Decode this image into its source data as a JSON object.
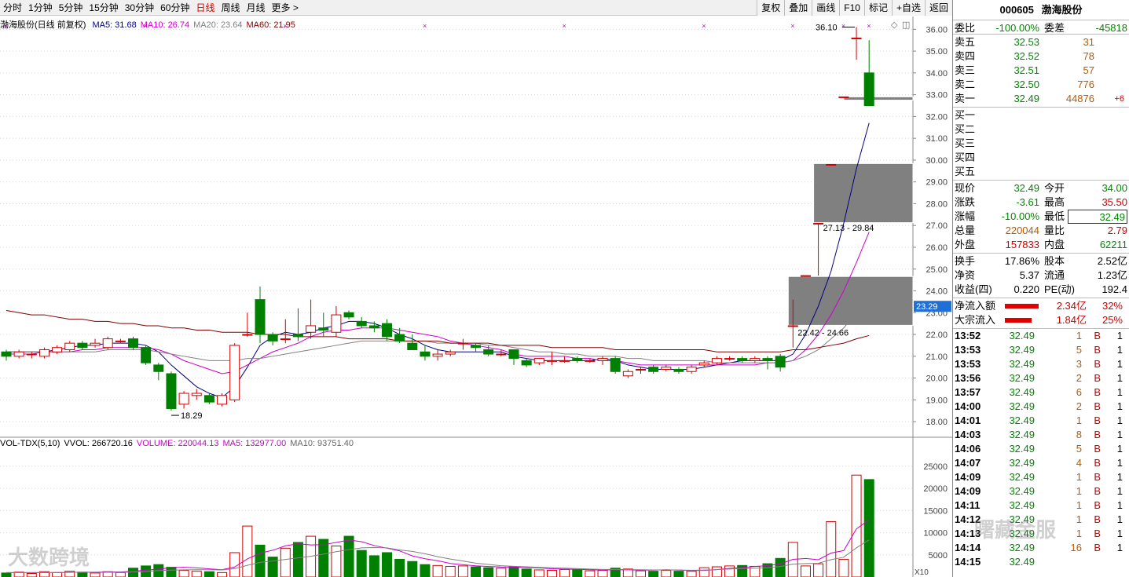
{
  "topbar": {
    "period_tabs": [
      "分时",
      "1分钟",
      "5分钟",
      "15分钟",
      "30分钟",
      "60分钟",
      "日线",
      "周线",
      "月线",
      "更多 >"
    ],
    "active_tab": "日线",
    "tools": [
      "复权",
      "叠加",
      "画线",
      "F10",
      "标记",
      "+自选",
      "返回"
    ]
  },
  "chart": {
    "title_prefix": "渤海股份(日线 前复权)",
    "ma": [
      {
        "label": "MA5: 31.68",
        "color": "#000080"
      },
      {
        "label": "MA10: 26.74",
        "color": "#cc00cc"
      },
      {
        "label": "MA20: 23.64",
        "color": "#808080"
      },
      {
        "label": "MA60: 21.95",
        "color": "#800000"
      }
    ],
    "price_axis": {
      "min": 17.5,
      "max": 36.3,
      "ticks": [
        18,
        19,
        20,
        21,
        22,
        23,
        24,
        25,
        26,
        27,
        28,
        29,
        30,
        31,
        32,
        33,
        34,
        35,
        36
      ]
    },
    "current_price_marker": "23.29",
    "annotations": {
      "low_label": "18.29",
      "high_label": "36.10",
      "gap_upper": "27.13 - 29.84",
      "gap_lower": "22.42 - 24.66"
    },
    "candles": [
      [
        21.2,
        21.0,
        21.3,
        20.8
      ],
      [
        21.0,
        21.2,
        21.3,
        20.9
      ],
      [
        21.1,
        21.1,
        21.2,
        20.9
      ],
      [
        21.0,
        21.3,
        21.4,
        20.9
      ],
      [
        21.2,
        21.4,
        21.5,
        21.1
      ],
      [
        21.3,
        21.6,
        21.7,
        21.2
      ],
      [
        21.6,
        21.4,
        21.7,
        21.3
      ],
      [
        21.5,
        21.6,
        21.8,
        21.4
      ],
      [
        21.4,
        21.8,
        21.9,
        21.3
      ],
      [
        21.7,
        21.7,
        21.8,
        21.6
      ],
      [
        21.8,
        21.4,
        21.9,
        21.3
      ],
      [
        21.4,
        20.7,
        21.5,
        20.6
      ],
      [
        20.6,
        20.3,
        20.7,
        19.9
      ],
      [
        20.2,
        18.6,
        20.3,
        18.5
      ],
      [
        18.8,
        19.3,
        19.4,
        18.6
      ],
      [
        19.2,
        19.3,
        19.5,
        19.0
      ],
      [
        19.2,
        18.9,
        19.3,
        18.8
      ],
      [
        18.8,
        19.2,
        19.3,
        18.7
      ],
      [
        19.0,
        21.5,
        21.6,
        18.9
      ],
      [
        22.0,
        22.0,
        23.0,
        21.9
      ],
      [
        23.6,
        22.0,
        24.2,
        21.6
      ],
      [
        22.0,
        21.7,
        22.1,
        21.5
      ],
      [
        21.8,
        21.8,
        22.7,
        21.6
      ],
      [
        22.0,
        21.9,
        23.2,
        21.7
      ],
      [
        22.1,
        22.4,
        23.6,
        21.8
      ],
      [
        22.3,
        22.2,
        23.0,
        21.9
      ],
      [
        22.1,
        22.9,
        23.3,
        21.9
      ],
      [
        23.0,
        22.8,
        23.1,
        22.7
      ],
      [
        22.6,
        22.4,
        22.8,
        22.3
      ],
      [
        22.4,
        22.3,
        22.6,
        22.1
      ],
      [
        22.5,
        21.9,
        22.7,
        21.7
      ],
      [
        22.0,
        21.7,
        22.3,
        21.6
      ],
      [
        21.6,
        21.3,
        22.0,
        21.3
      ],
      [
        21.2,
        21.0,
        21.5,
        20.8
      ],
      [
        21.0,
        21.1,
        21.3,
        20.8
      ],
      [
        21.1,
        21.2,
        21.3,
        21.0
      ],
      [
        21.6,
        21.6,
        21.8,
        21.3
      ],
      [
        21.5,
        21.4,
        21.6,
        21.2
      ],
      [
        21.3,
        21.1,
        21.5,
        21.0
      ],
      [
        21.1,
        21.1,
        21.3,
        21.0
      ],
      [
        21.3,
        20.9,
        21.3,
        20.6
      ],
      [
        20.8,
        20.6,
        20.9,
        20.5
      ],
      [
        20.7,
        20.9,
        20.9,
        20.6
      ],
      [
        20.8,
        20.8,
        21.2,
        20.6
      ],
      [
        20.8,
        20.8,
        21.0,
        20.7
      ],
      [
        20.9,
        20.8,
        21.0,
        20.7
      ],
      [
        20.8,
        20.8,
        20.9,
        20.7
      ],
      [
        20.8,
        20.9,
        21.0,
        20.6
      ],
      [
        20.9,
        20.3,
        21.0,
        20.2
      ],
      [
        20.1,
        20.3,
        20.4,
        20.0
      ],
      [
        20.4,
        20.4,
        20.5,
        20.2
      ],
      [
        20.5,
        20.3,
        20.6,
        20.2
      ],
      [
        20.4,
        20.5,
        20.6,
        20.3
      ],
      [
        20.4,
        20.3,
        20.5,
        20.2
      ],
      [
        20.3,
        20.5,
        20.6,
        20.2
      ],
      [
        20.6,
        20.7,
        20.8,
        20.5
      ],
      [
        20.7,
        20.9,
        21.0,
        20.6
      ],
      [
        20.9,
        20.9,
        21.0,
        20.8
      ],
      [
        20.9,
        20.8,
        21.0,
        20.7
      ],
      [
        20.8,
        20.9,
        21.0,
        20.7
      ],
      [
        20.9,
        20.8,
        21.0,
        20.4
      ],
      [
        21.0,
        20.5,
        21.1,
        20.3
      ],
      [
        22.4,
        22.4,
        23.6,
        21.4
      ],
      [
        24.7,
        24.7,
        24.7,
        24.7
      ],
      [
        27.1,
        27.1,
        27.1,
        24.7
      ],
      [
        29.8,
        29.8,
        29.8,
        29.8
      ],
      [
        32.9,
        32.9,
        32.9,
        32.9
      ],
      [
        35.6,
        35.6,
        36.1,
        34.6
      ],
      [
        34.0,
        32.5,
        35.5,
        32.5
      ]
    ],
    "gaps": [
      [
        22.42,
        24.66
      ],
      [
        27.13,
        29.84
      ],
      [
        32.75,
        32.9
      ]
    ],
    "ma_lines": {
      "ma5": [
        21.2,
        21.2,
        21.2,
        21.2,
        21.3,
        21.4,
        21.5,
        21.5,
        21.6,
        21.6,
        21.6,
        21.5,
        21.2,
        20.6,
        20.1,
        19.6,
        19.3,
        19.1,
        19.6,
        20.5,
        21.5,
        21.9,
        22.1,
        22.0,
        22.1,
        22.3,
        22.4,
        22.6,
        22.6,
        22.5,
        22.3,
        22.0,
        21.8,
        21.5,
        21.3,
        21.2,
        21.2,
        21.2,
        21.2,
        21.2,
        21.0,
        20.9,
        20.8,
        20.8,
        20.8,
        20.8,
        20.8,
        20.9,
        20.8,
        20.6,
        20.5,
        20.4,
        20.4,
        20.4,
        20.4,
        20.5,
        20.6,
        20.7,
        20.8,
        20.8,
        20.8,
        20.8,
        21.1,
        22.0,
        23.3,
        24.9,
        27.1,
        29.6,
        31.7
      ],
      "ma10": [
        21.1,
        21.1,
        21.1,
        21.2,
        21.2,
        21.2,
        21.3,
        21.3,
        21.4,
        21.4,
        21.4,
        21.4,
        21.3,
        21.1,
        20.8,
        20.6,
        20.4,
        20.2,
        20.3,
        20.6,
        20.9,
        21.2,
        21.4,
        21.6,
        21.9,
        22.1,
        22.2,
        22.2,
        22.3,
        22.3,
        22.3,
        22.2,
        22.1,
        22.0,
        21.9,
        21.7,
        21.6,
        21.5,
        21.4,
        21.3,
        21.1,
        21.0,
        21.0,
        21.0,
        21.0,
        20.9,
        20.9,
        20.8,
        20.8,
        20.7,
        20.6,
        20.6,
        20.6,
        20.6,
        20.6,
        20.6,
        20.6,
        20.6,
        20.6,
        20.6,
        20.7,
        20.7,
        20.8,
        21.3,
        22.0,
        22.9,
        24.0,
        25.3,
        26.7
      ],
      "ma20": [
        21.2,
        21.2,
        21.2,
        21.2,
        21.2,
        21.2,
        21.2,
        21.2,
        21.3,
        21.3,
        21.3,
        21.3,
        21.2,
        21.1,
        21.0,
        20.9,
        20.8,
        20.8,
        20.8,
        20.9,
        20.9,
        21.0,
        21.1,
        21.2,
        21.3,
        21.4,
        21.5,
        21.6,
        21.7,
        21.7,
        21.7,
        21.7,
        21.7,
        21.7,
        21.6,
        21.6,
        21.6,
        21.6,
        21.5,
        21.5,
        21.4,
        21.3,
        21.2,
        21.2,
        21.1,
        21.1,
        21.0,
        21.0,
        21.0,
        20.9,
        20.9,
        20.8,
        20.8,
        20.8,
        20.8,
        20.8,
        20.7,
        20.7,
        20.7,
        20.7,
        20.7,
        20.7,
        20.8,
        21.0,
        21.3,
        21.8,
        22.3,
        23.0,
        23.6
      ],
      "ma60": [
        23.1,
        23.0,
        22.9,
        22.9,
        22.8,
        22.7,
        22.7,
        22.6,
        22.6,
        22.5,
        22.5,
        22.4,
        22.4,
        22.3,
        22.3,
        22.2,
        22.2,
        22.1,
        22.1,
        22.1,
        22.0,
        22.0,
        22.0,
        21.9,
        21.9,
        21.9,
        21.9,
        21.8,
        21.8,
        21.8,
        21.8,
        21.7,
        21.7,
        21.7,
        21.7,
        21.6,
        21.6,
        21.6,
        21.6,
        21.5,
        21.5,
        21.5,
        21.5,
        21.4,
        21.4,
        21.4,
        21.4,
        21.4,
        21.3,
        21.3,
        21.3,
        21.3,
        21.3,
        21.3,
        21.3,
        21.3,
        21.2,
        21.2,
        21.2,
        21.2,
        21.2,
        21.2,
        21.3,
        21.3,
        21.4,
        21.5,
        21.6,
        21.8,
        21.95
      ]
    },
    "cross_markers": [
      0,
      11,
      22,
      33,
      44,
      55,
      62,
      66,
      68
    ],
    "volume_legend": [
      {
        "label": "VOL-TDX(5,10)",
        "color": "#000000"
      },
      {
        "label": "VVOL: 266720.16",
        "color": "#000000"
      },
      {
        "label": "VOLUME: 220044.13",
        "color": "#cc00cc"
      },
      {
        "label": "MA5: 132977.00",
        "color": "#cc00cc"
      },
      {
        "label": "MA10: 93751.40",
        "color": "#666666"
      }
    ],
    "volume_axis": {
      "min": 0,
      "max": 28000,
      "ticks": [
        5000,
        10000,
        15000,
        20000,
        25000
      ],
      "tick_labels": [
        "5000",
        "10000",
        "15000",
        "20000",
        "25000"
      ],
      "unit_label": "X10"
    },
    "volumes": [
      900,
      1100,
      800,
      1200,
      1000,
      1300,
      1100,
      900,
      1200,
      1000,
      2000,
      2500,
      2800,
      2200,
      1500,
      1300,
      1200,
      1000,
      5500,
      11500,
      7200,
      4500,
      6500,
      7800,
      9200,
      8500,
      7000,
      9200,
      6000,
      4800,
      5500,
      4000,
      3500,
      2800,
      2600,
      2400,
      2500,
      2300,
      2100,
      2000,
      2300,
      1800,
      1600,
      1500,
      1700,
      1600,
      1400,
      1500,
      2000,
      1800,
      1400,
      1300,
      1500,
      1300,
      1300,
      2100,
      2300,
      2500,
      2600,
      2400,
      3000,
      4200,
      7800,
      2500,
      3000,
      12500,
      4000,
      23000,
      22000
    ],
    "volume_ma5": [
      1000,
      1000,
      1000,
      1000,
      1000,
      1040,
      1080,
      1080,
      1160,
      1140,
      1300,
      1540,
      1780,
      2100,
      2200,
      2060,
      1840,
      1640,
      2260,
      4080,
      5380,
      6040,
      7040,
      7500,
      7240,
      7300,
      7800,
      8340,
      7980,
      7100,
      6500,
      5900,
      4760,
      4120,
      3680,
      3060,
      2760,
      2520,
      2380,
      2260,
      2240,
      2140,
      2060,
      1860,
      1780,
      1720,
      1640,
      1560,
      1640,
      1620,
      1540,
      1560,
      1640,
      1560,
      1460,
      1480,
      1660,
      1940,
      2160,
      2380,
      2560,
      2940,
      3980,
      4180,
      3900,
      5400,
      5960,
      10860,
      12900
    ],
    "volume_ma10": [
      1000,
      1000,
      1000,
      1000,
      1000,
      1050,
      1060,
      1040,
      1070,
      1050,
      1120,
      1270,
      1430,
      1560,
      1620,
      1640,
      1630,
      1600,
      1890,
      2630,
      3300,
      3600,
      3970,
      4320,
      4680,
      5170,
      5710,
      6170,
      6570,
      6650,
      6580,
      6100,
      5790,
      5250,
      4590,
      4060,
      3620,
      3130,
      2830,
      2540,
      2420,
      2300,
      2180,
      2080,
      1990,
      1900,
      1790,
      1710,
      1700,
      1690,
      1640,
      1600,
      1590,
      1570,
      1530,
      1580,
      1670,
      1790,
      1900,
      1970,
      2100,
      2380,
      2900,
      3040,
      3110,
      3920,
      4460,
      6590,
      8380
    ]
  },
  "panel": {
    "code": "000605",
    "name": "渤海股份",
    "weibi": {
      "label": "委比",
      "value": "-100.00%",
      "label2": "委差",
      "value2": "-45818"
    },
    "sells": [
      {
        "label": "卖五",
        "price": "32.53",
        "vol": "31",
        "chg": ""
      },
      {
        "label": "卖四",
        "price": "32.52",
        "vol": "78",
        "chg": ""
      },
      {
        "label": "卖三",
        "price": "32.51",
        "vol": "57",
        "chg": ""
      },
      {
        "label": "卖二",
        "price": "32.50",
        "vol": "776",
        "chg": ""
      },
      {
        "label": "卖一",
        "price": "32.49",
        "vol": "44876",
        "chg": "+6"
      }
    ],
    "buys": [
      {
        "label": "买一"
      },
      {
        "label": "买二"
      },
      {
        "label": "买三"
      },
      {
        "label": "买四"
      },
      {
        "label": "买五"
      }
    ],
    "quote1": [
      {
        "l1": "现价",
        "v1": "32.49",
        "l2": "今开",
        "v2": "34.00"
      },
      {
        "l1": "涨跌",
        "v1": "-3.61",
        "l2": "最高",
        "v2": "35.50"
      },
      {
        "l1": "涨幅",
        "v1": "-10.00%",
        "l2": "最低",
        "v2": "32.49"
      },
      {
        "l1": "总量",
        "v1": "220044",
        "l2": "量比",
        "v2": "2.79"
      },
      {
        "l1": "外盘",
        "v1": "157833",
        "l2": "内盘",
        "v2": "62211"
      }
    ],
    "quote2": [
      {
        "l1": "换手",
        "v1": "17.86%",
        "l2": "股本",
        "v2": "2.52亿"
      },
      {
        "l1": "净资",
        "v1": "5.37",
        "l2": "流通",
        "v2": "1.23亿"
      },
      {
        "l1": "收益(四)",
        "v1": "0.220",
        "l2": "PE(动)",
        "v2": "192.4"
      }
    ],
    "flows": [
      {
        "label": "净流入额",
        "bar": 0.9,
        "value": "2.34亿",
        "pct": "32%"
      },
      {
        "label": "大宗流入",
        "bar": 0.7,
        "value": "1.84亿",
        "pct": "25%"
      }
    ],
    "ticks": [
      {
        "time": "13:52",
        "price": "32.49",
        "vol": "1",
        "side": "B",
        "n": "1"
      },
      {
        "time": "13:53",
        "price": "32.49",
        "vol": "5",
        "side": "B",
        "n": "1"
      },
      {
        "time": "13:53",
        "price": "32.49",
        "vol": "3",
        "side": "B",
        "n": "1"
      },
      {
        "time": "13:56",
        "price": "32.49",
        "vol": "2",
        "side": "B",
        "n": "1"
      },
      {
        "time": "13:57",
        "price": "32.49",
        "vol": "6",
        "side": "B",
        "n": "1"
      },
      {
        "time": "14:00",
        "price": "32.49",
        "vol": "2",
        "side": "B",
        "n": "1"
      },
      {
        "time": "14:01",
        "price": "32.49",
        "vol": "1",
        "side": "B",
        "n": "1"
      },
      {
        "time": "14:03",
        "price": "32.49",
        "vol": "8",
        "side": "B",
        "n": "1"
      },
      {
        "time": "14:06",
        "price": "32.49",
        "vol": "5",
        "side": "B",
        "n": "1"
      },
      {
        "time": "14:07",
        "price": "32.49",
        "vol": "4",
        "side": "B",
        "n": "1"
      },
      {
        "time": "14:09",
        "price": "32.49",
        "vol": "1",
        "side": "B",
        "n": "1"
      },
      {
        "time": "14:09",
        "price": "32.49",
        "vol": "1",
        "side": "B",
        "n": "1"
      },
      {
        "time": "14:11",
        "price": "32.49",
        "vol": "1",
        "side": "B",
        "n": "1"
      },
      {
        "time": "14:12",
        "price": "32.49",
        "vol": "1",
        "side": "B",
        "n": "1"
      },
      {
        "time": "14:13",
        "price": "32.49",
        "vol": "1",
        "side": "B",
        "n": "1"
      },
      {
        "time": "14:14",
        "price": "32.49",
        "vol": "16",
        "side": "B",
        "n": "1"
      },
      {
        "time": "14:15",
        "price": "32.49",
        "vol": "",
        "side": "",
        "n": ""
      }
    ]
  },
  "watermarks": {
    "left": "大数跨境",
    "right": "曙藏金服"
  },
  "colors": {
    "up": "#d00000",
    "down": "#008000",
    "gap": "#808080"
  }
}
